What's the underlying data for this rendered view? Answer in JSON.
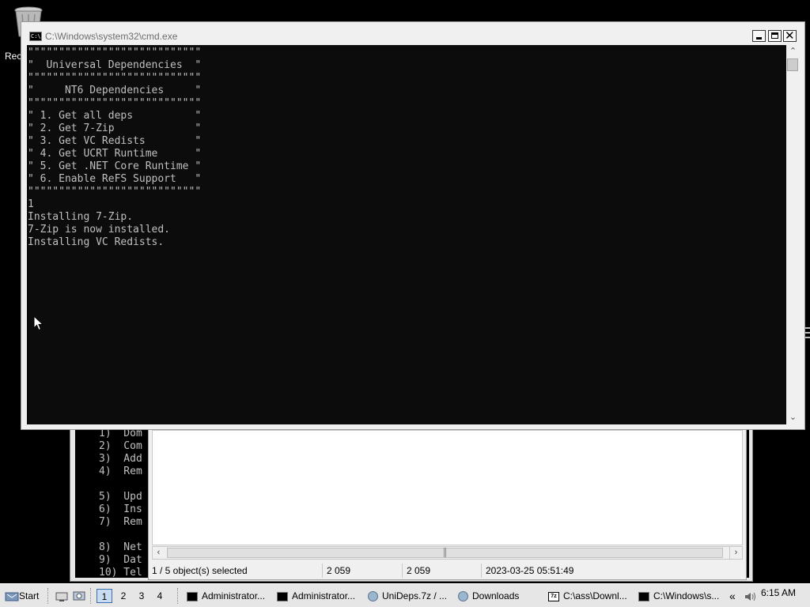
{
  "desktop": {
    "recycle_bin_label": "Rec"
  },
  "cmd_window": {
    "title": "C:\\Windows\\system32\\cmd.exe",
    "console_lines": [
      "\"\"\"\"\"\"\"\"\"\"\"\"\"\"\"\"\"\"\"\"\"\"\"\"\"\"\"\"",
      "\"  Universal Dependencies  \"",
      "\"\"\"\"\"\"\"\"\"\"\"\"\"\"\"\"\"\"\"\"\"\"\"\"\"\"\"\"",
      "\"     NT6 Dependencies     \"",
      "\"\"\"\"\"\"\"\"\"\"\"\"\"\"\"\"\"\"\"\"\"\"\"\"\"\"\"\"",
      "\" 1. Get all deps          \"",
      "\" 2. Get 7-Zip             \"",
      "\" 3. Get VC Redists        \"",
      "\" 4. Get UCRT Runtime      \"",
      "\" 5. Get .NET Core Runtime \"",
      "\" 6. Enable ReFS Support   \"",
      "\"\"\"\"\"\"\"\"\"\"\"\"\"\"\"\"\"\"\"\"\"\"\"\"\"\"\"\"",
      "1",
      "Installing 7-Zip.",
      "7-Zip is now installed.",
      "Installing VC Redists."
    ]
  },
  "background_console": {
    "lines": [
      "1)  Dom",
      "2)  Com",
      "3)  Add",
      "4)  Rem",
      "",
      "5)  Upd",
      "6)  Ins",
      "7)  Rem",
      "",
      "8)  Net",
      "9)  Dat",
      "10) Tel"
    ]
  },
  "file_manager": {
    "status": {
      "selection": "1 / 5 object(s) selected",
      "size": "2 059",
      "packed_size": "2 059",
      "modified": "2023-03-25 05:51:49"
    }
  },
  "taskbar": {
    "start_label": "Start",
    "workspaces": [
      "1",
      "2",
      "3",
      "4"
    ],
    "active_workspace": "1",
    "items": [
      {
        "label": "Administrator...",
        "icon": "cmd-icon"
      },
      {
        "label": "Administrator...",
        "icon": "cmd-icon"
      },
      {
        "label": "UniDeps.7z / ...",
        "icon": "disk-icon"
      },
      {
        "label": "Downloads",
        "icon": "disk-icon"
      },
      {
        "label": "C:\\ass\\Downl...",
        "icon": "7zip-icon"
      },
      {
        "label": "C:\\Windows\\s...",
        "icon": "cmd-icon"
      }
    ],
    "tray_expand": "«",
    "clock": "6:15 AM"
  }
}
